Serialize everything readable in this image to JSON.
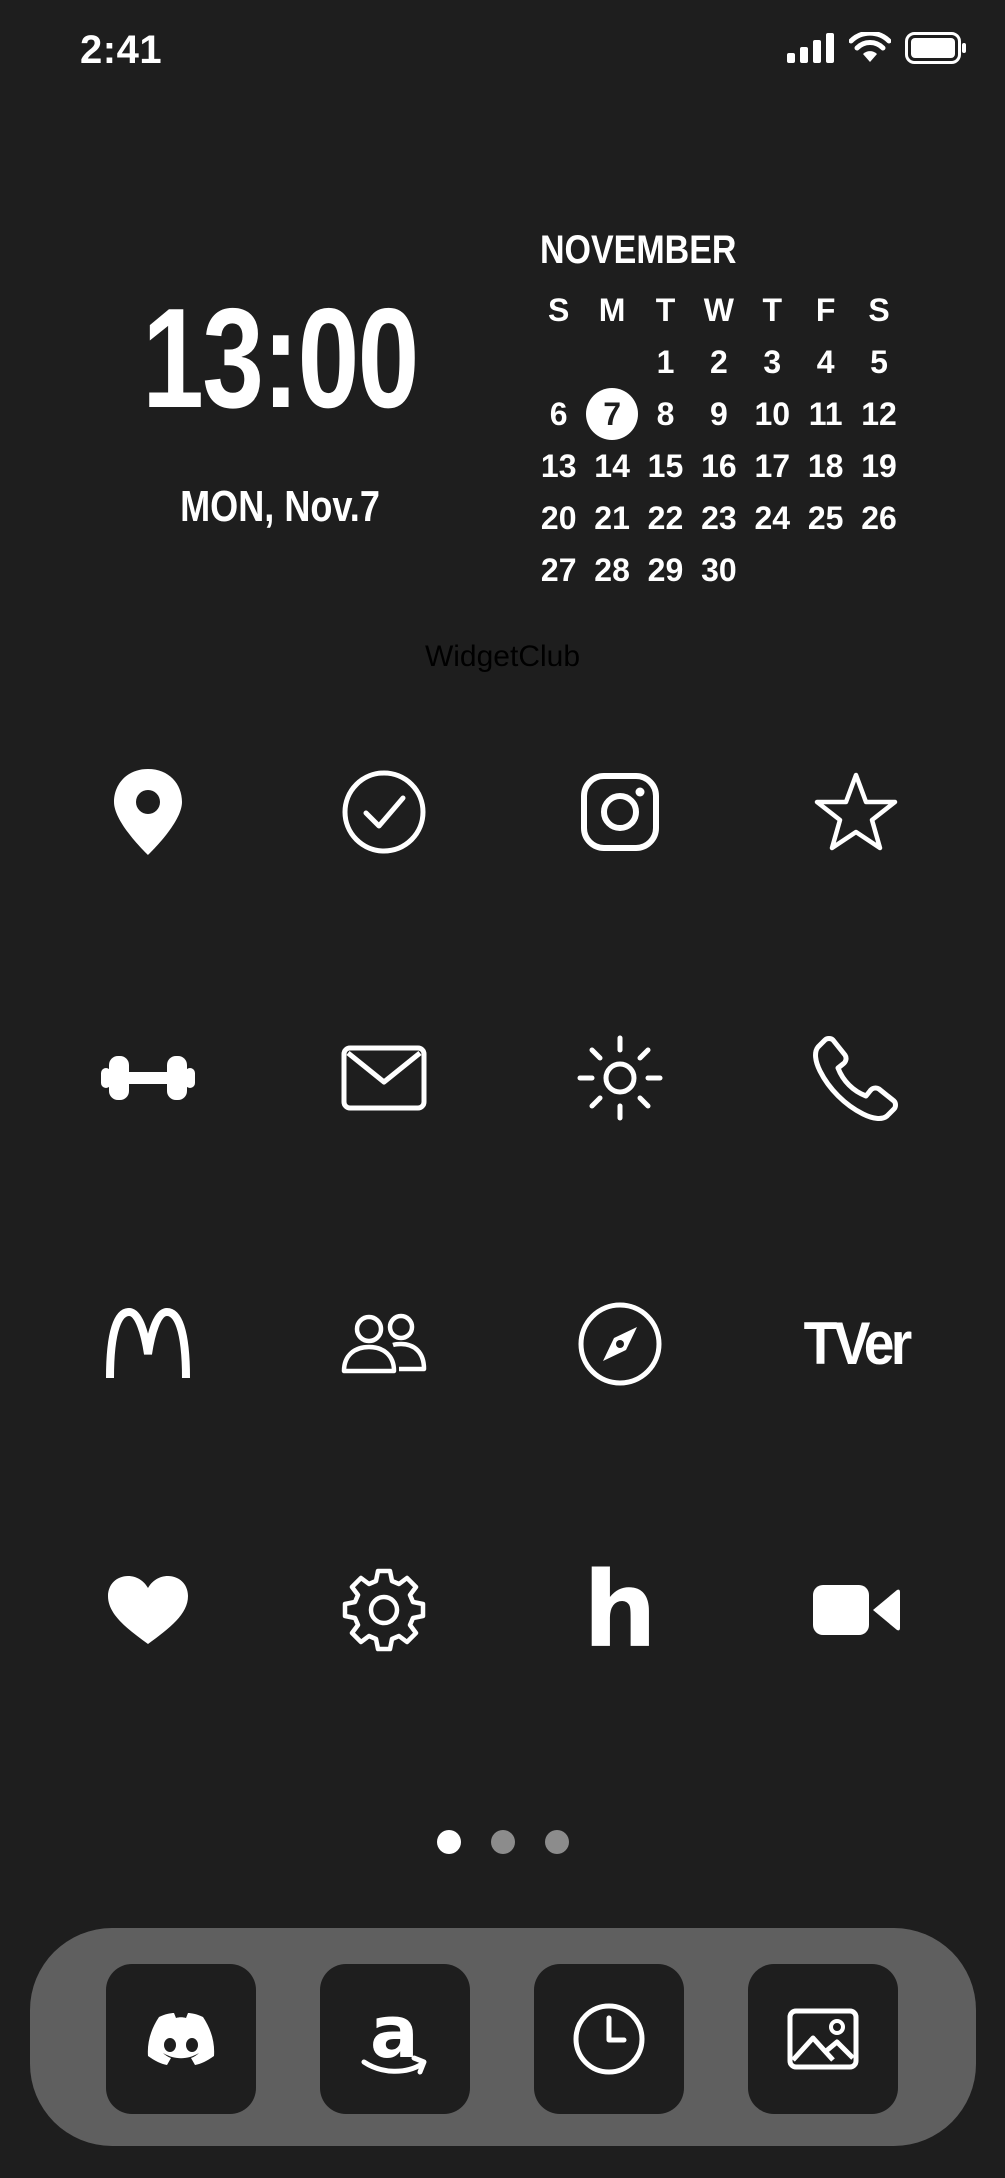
{
  "status_bar": {
    "time": "2:41"
  },
  "clock_widget": {
    "time": "13:00",
    "date": "MON, Nov.7"
  },
  "calendar_widget": {
    "month": "NOVEMBER",
    "weekdays": [
      "S",
      "M",
      "T",
      "W",
      "T",
      "F",
      "S"
    ],
    "days": [
      "",
      "",
      "1",
      "2",
      "3",
      "4",
      "5",
      "6",
      "7",
      "8",
      "9",
      "10",
      "11",
      "12",
      "13",
      "14",
      "15",
      "16",
      "17",
      "18",
      "19",
      "20",
      "21",
      "22",
      "23",
      "24",
      "25",
      "26",
      "27",
      "28",
      "29",
      "30",
      "",
      "",
      ""
    ],
    "today": "7"
  },
  "widget_caption": "WidgetClub",
  "apps": {
    "tver_label": "TVer",
    "hulu_label": "h",
    "amazon_label": "a"
  },
  "page_dots": {
    "count": 3,
    "active": 0
  }
}
